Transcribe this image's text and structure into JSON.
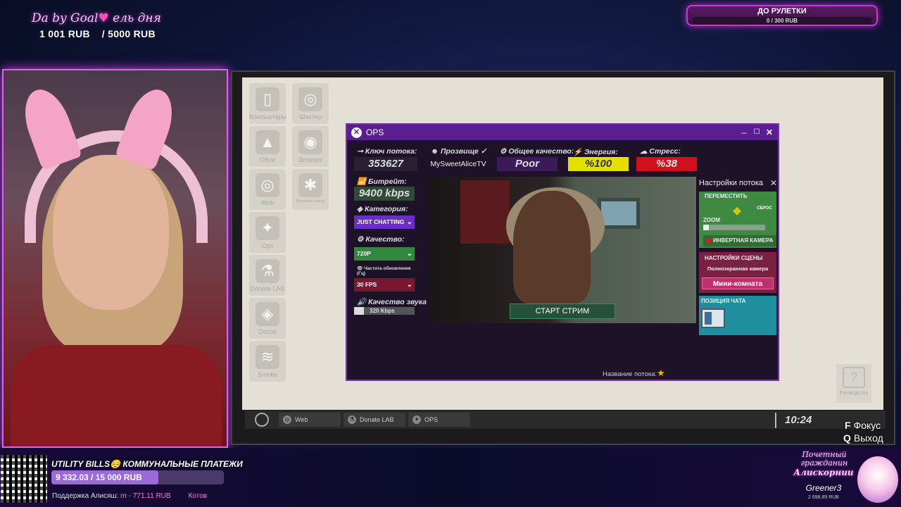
{
  "overlay": {
    "goal_title": "Da by Goal",
    "goal_heart": "♥",
    "goal_suffix": "ель дня",
    "goal_current": "1 001 RUB",
    "goal_target": "/ 5000 RUB",
    "roulette_label": "ДО РУЛЕТКИ",
    "roulette_value": "0 / 300 RUB",
    "bills_title": "UTILITY BILLS😔 КОММУНАЛЬНЫЕ ПЛАТЕЖИ",
    "bills_value": "9 332.03 / 15 000 RUB",
    "bills_progress": 0.62,
    "support_text": "Поддержка Алисяш:",
    "support_donor": "rn - 771.11 RUB",
    "support_next": "Котов",
    "citizen_title": "Почетный гражданин",
    "citizen_name": "Алискорнии",
    "citizen_user": "Greener3",
    "citizen_amount": "2 698.89 RUB"
  },
  "desktop": {
    "icons": [
      {
        "label": "Компьютеры",
        "icon": "computer-icon",
        "glyph": "▯"
      },
      {
        "label": "Шахтер",
        "icon": "miner-icon",
        "glyph": "◎"
      },
      {
        "label": "Обои",
        "icon": "wallpaper-icon",
        "glyph": "▲"
      },
      {
        "label": "Browser",
        "icon": "browser-icon",
        "glyph": "◉"
      },
      {
        "label": "Web",
        "icon": "web-icon",
        "glyph": "◎"
      },
      {
        "label": "Вирусный сканер",
        "icon": "bug-icon",
        "glyph": "✱"
      },
      {
        "label": "Ops",
        "icon": "ops-icon",
        "glyph": "✦"
      },
      {
        "label": "Donate LAB",
        "icon": "flask-icon",
        "glyph": "⚗"
      },
      {
        "label": "Discat",
        "icon": "cat-icon",
        "glyph": "◈"
      },
      {
        "label": "Smoke",
        "icon": "smoke-icon",
        "glyph": "≋"
      }
    ],
    "help_label": "Руководства"
  },
  "ops": {
    "title": "OPS",
    "stream_key_label": "Ключ потока:",
    "stream_key": "353627",
    "streamer_label": "Прозвище",
    "streamer_name": "MySweetAliceTV",
    "quality_label": "Общее качество:",
    "quality_value": "Poor",
    "energy_label": "Энергия:",
    "energy_value": "%100",
    "stress_label": "Стресс:",
    "stress_value": "%38",
    "bitrate_label": "Битрейт:",
    "bitrate_value": "9400 kbps",
    "category_label": "Категория:",
    "category_value": "JUST CHATTING",
    "video_quality_label": "Качество:",
    "video_quality_value": "720P",
    "refresh_label": "Частота обновления (Гц)",
    "fps_value": "30 FPS",
    "audio_label": "Качество звука",
    "audio_value": "320 Kbps",
    "start_button": "СТАРТ СТРИМ",
    "stream_name_label": "Название потока:",
    "settings_title": "Настройки потока",
    "move_label": "ПЕРЕМЕСТИТЬ",
    "reset_label": "СБРОС",
    "zoom_label": "ZOOM",
    "invert_label": "ИНВЕРТНАЯ КАМЕРА",
    "scene_label": "НАСТРОЙКИ СЦЕНЫ",
    "fullscreen_label": "Полноэкранная камера",
    "mini_room_label": "Мини-комната",
    "chat_pos_label": "ПОЗИЦИЯ ЧАТА"
  },
  "taskbar": {
    "items": [
      {
        "label": "Web",
        "glyph": "◎"
      },
      {
        "label": "Donate LAB",
        "glyph": "⚗"
      },
      {
        "label": "OPS",
        "glyph": "✦"
      }
    ],
    "clock": "10:24"
  },
  "hints": {
    "focus_key": "F",
    "focus_label": "Фокус",
    "exit_key": "Q",
    "exit_label": "Выход"
  }
}
